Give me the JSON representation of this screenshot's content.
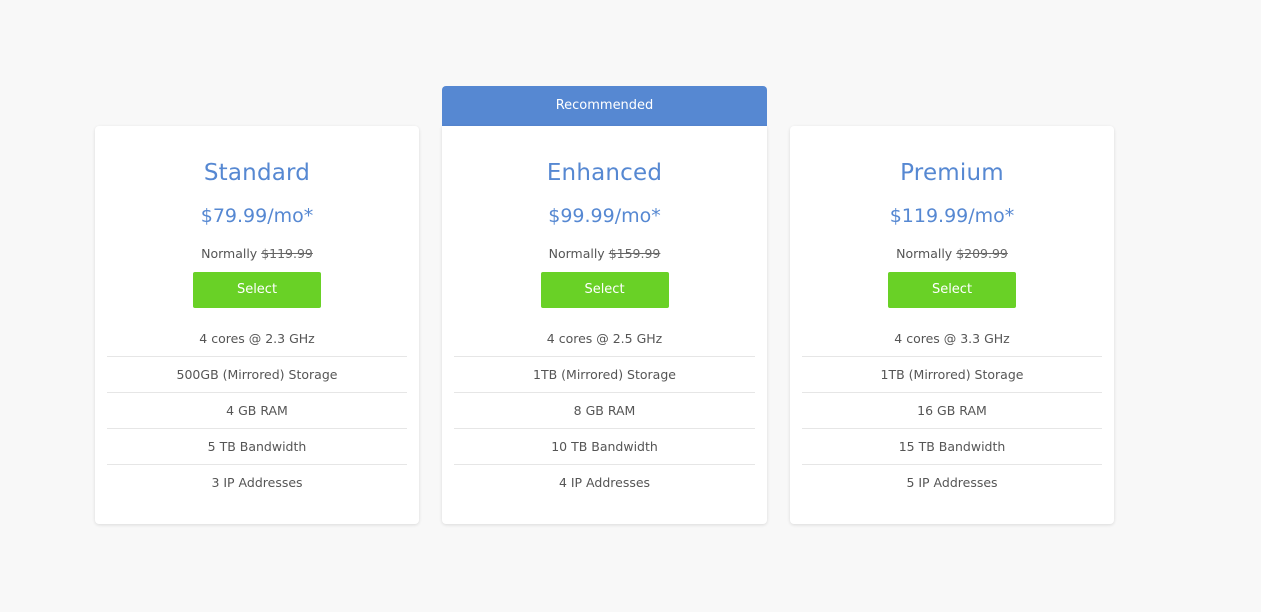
{
  "recommended_label": "Recommended",
  "normally_label": "Normally",
  "colors": {
    "accent": "#5688d2",
    "select_button": "#69d126",
    "background": "#f8f8f8",
    "card": "#ffffff"
  },
  "plans": [
    {
      "name": "Standard",
      "price": "$79.99/mo*",
      "old_price": "$119.99",
      "button": "Select",
      "features": [
        "4 cores @ 2.3 GHz",
        "500GB (Mirrored) Storage",
        "4 GB RAM",
        "5 TB Bandwidth",
        "3 IP Addresses"
      ]
    },
    {
      "name": "Enhanced",
      "price": "$99.99/mo*",
      "old_price": "$159.99",
      "button": "Select",
      "recommended": true,
      "features": [
        "4 cores @ 2.5 GHz",
        "1TB (Mirrored) Storage",
        "8 GB RAM",
        "10 TB Bandwidth",
        "4 IP Addresses"
      ]
    },
    {
      "name": "Premium",
      "price": "$119.99/mo*",
      "old_price": "$209.99",
      "button": "Select",
      "features": [
        "4 cores @ 3.3 GHz",
        "1TB (Mirrored) Storage",
        "16 GB RAM",
        "15 TB Bandwidth",
        "5 IP Addresses"
      ]
    }
  ]
}
